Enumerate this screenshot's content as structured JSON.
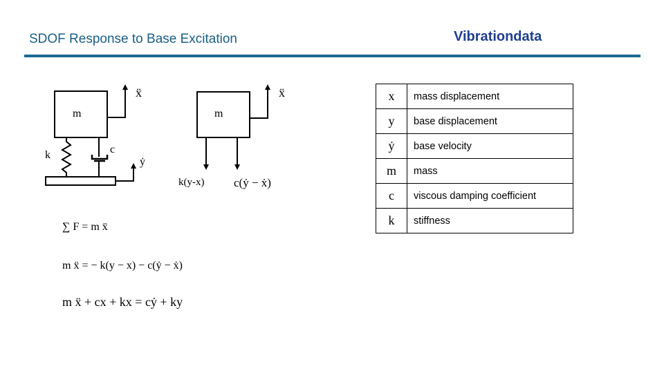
{
  "header": {
    "title": "SDOF Response to Base Excitation",
    "brand": "Vibrationdata",
    "accent_color": "#1a6a8f"
  },
  "diagram": {
    "left": {
      "mass": "m",
      "spring": "k",
      "damper": "c",
      "mass_accel": "ẍ",
      "base_accel": "ẏ"
    },
    "right": {
      "mass": "m",
      "mass_accel": "ẍ",
      "spring_force": "k(y-x)",
      "damper_force": "c(ẏ − ẋ)"
    }
  },
  "equations": [
    "∑ F = m ẍ",
    "m ẍ = − k(y − x) − c(ẏ − ẋ)",
    "m ẍ + cx + kx = cẏ + ky"
  ],
  "legend_table": [
    {
      "symbol": "x",
      "description": "mass displacement"
    },
    {
      "symbol": "y",
      "description": "base displacement"
    },
    {
      "symbol": "ẏ",
      "description": "base velocity"
    },
    {
      "symbol": "m",
      "description": "mass"
    },
    {
      "symbol": "c",
      "description": "viscous damping coefficient"
    },
    {
      "symbol": "k",
      "description": "stiffness"
    }
  ]
}
